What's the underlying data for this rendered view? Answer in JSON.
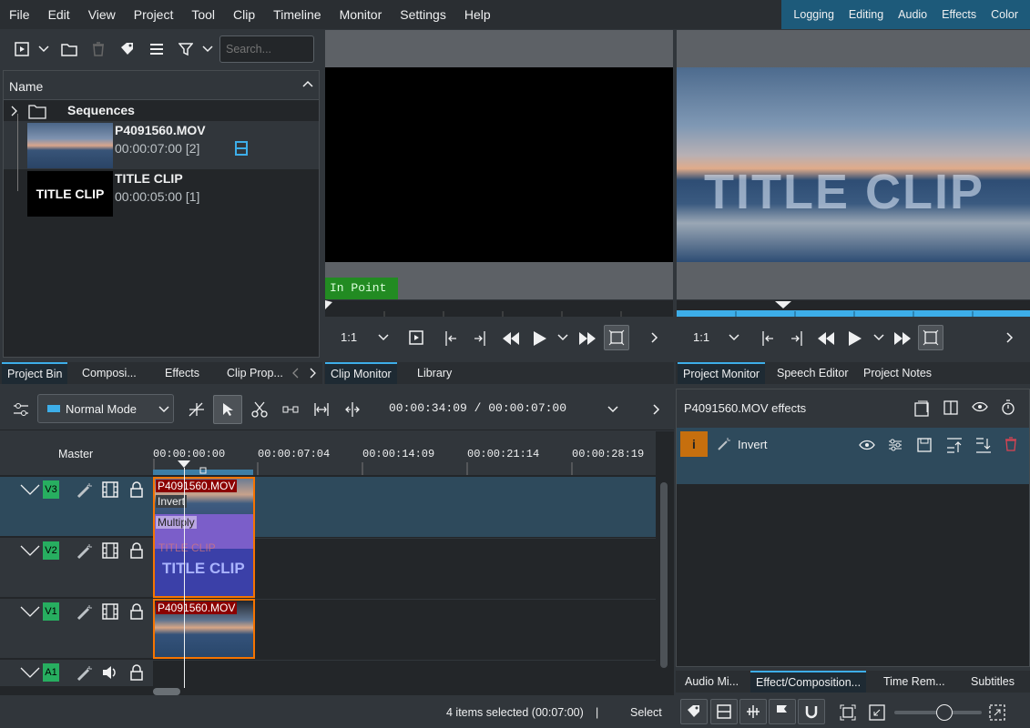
{
  "menubar": {
    "items": [
      "File",
      "Edit",
      "View",
      "Project",
      "Tool",
      "Clip",
      "Timeline",
      "Monitor",
      "Settings",
      "Help"
    ],
    "layouts": [
      "Logging",
      "Editing",
      "Audio",
      "Effects",
      "Color"
    ]
  },
  "bin": {
    "search_placeholder": "Search...",
    "column_name": "Name",
    "folder": "Sequences",
    "clips": [
      {
        "name": "P4091560.MOV",
        "duration": "00:00:07:00 [2]"
      },
      {
        "name": "TITLE CLIP",
        "duration": "00:00:05:00 [1]",
        "thumb_text": "TITLE CLIP"
      }
    ],
    "tabs": [
      "Project Bin",
      "Composi...",
      "Effects",
      "Clip Prop..."
    ]
  },
  "clip_monitor": {
    "in_point": "In Point",
    "zoom": "1:1",
    "tabs": [
      "Clip Monitor",
      "Library"
    ]
  },
  "project_monitor": {
    "overlay_text": "TITLE CLIP",
    "zoom": "1:1",
    "tabs": [
      "Project Monitor",
      "Speech Editor",
      "Project Notes"
    ]
  },
  "timeline_toolbar": {
    "mode": "Normal Mode",
    "timecode": "00:00:34:09 / 00:00:07:00"
  },
  "timeline": {
    "master": "Master",
    "ruler": [
      "00:00:00:00",
      "00:00:07:04",
      "00:00:14:09",
      "00:00:21:14",
      "00:00:28:19"
    ],
    "tracks": [
      {
        "id": "V3",
        "clip": "P4091560.MOV",
        "effect": "Invert",
        "composite": "Multiply"
      },
      {
        "id": "V2",
        "clip": "TITLE CLIP",
        "ghost": "TITLE CLIP"
      },
      {
        "id": "V1",
        "clip": "P4091560.MOV"
      },
      {
        "id": "A1"
      }
    ]
  },
  "effects_panel": {
    "title": "P4091560.MOV effects",
    "effect_badge": "i",
    "effect_name": "Invert",
    "tabs": [
      "Audio Mi...",
      "Effect/Composition...",
      "Time Rem...",
      "Subtitles"
    ]
  },
  "statusbar": {
    "selection": "4 items selected (00:07:00)",
    "separator": "|",
    "select_label": "Select"
  },
  "colors": {
    "accent": "#3daee9",
    "track_label": "#27ae60",
    "clip_border": "#f67400",
    "clip_title_bg": "#8b0000"
  }
}
